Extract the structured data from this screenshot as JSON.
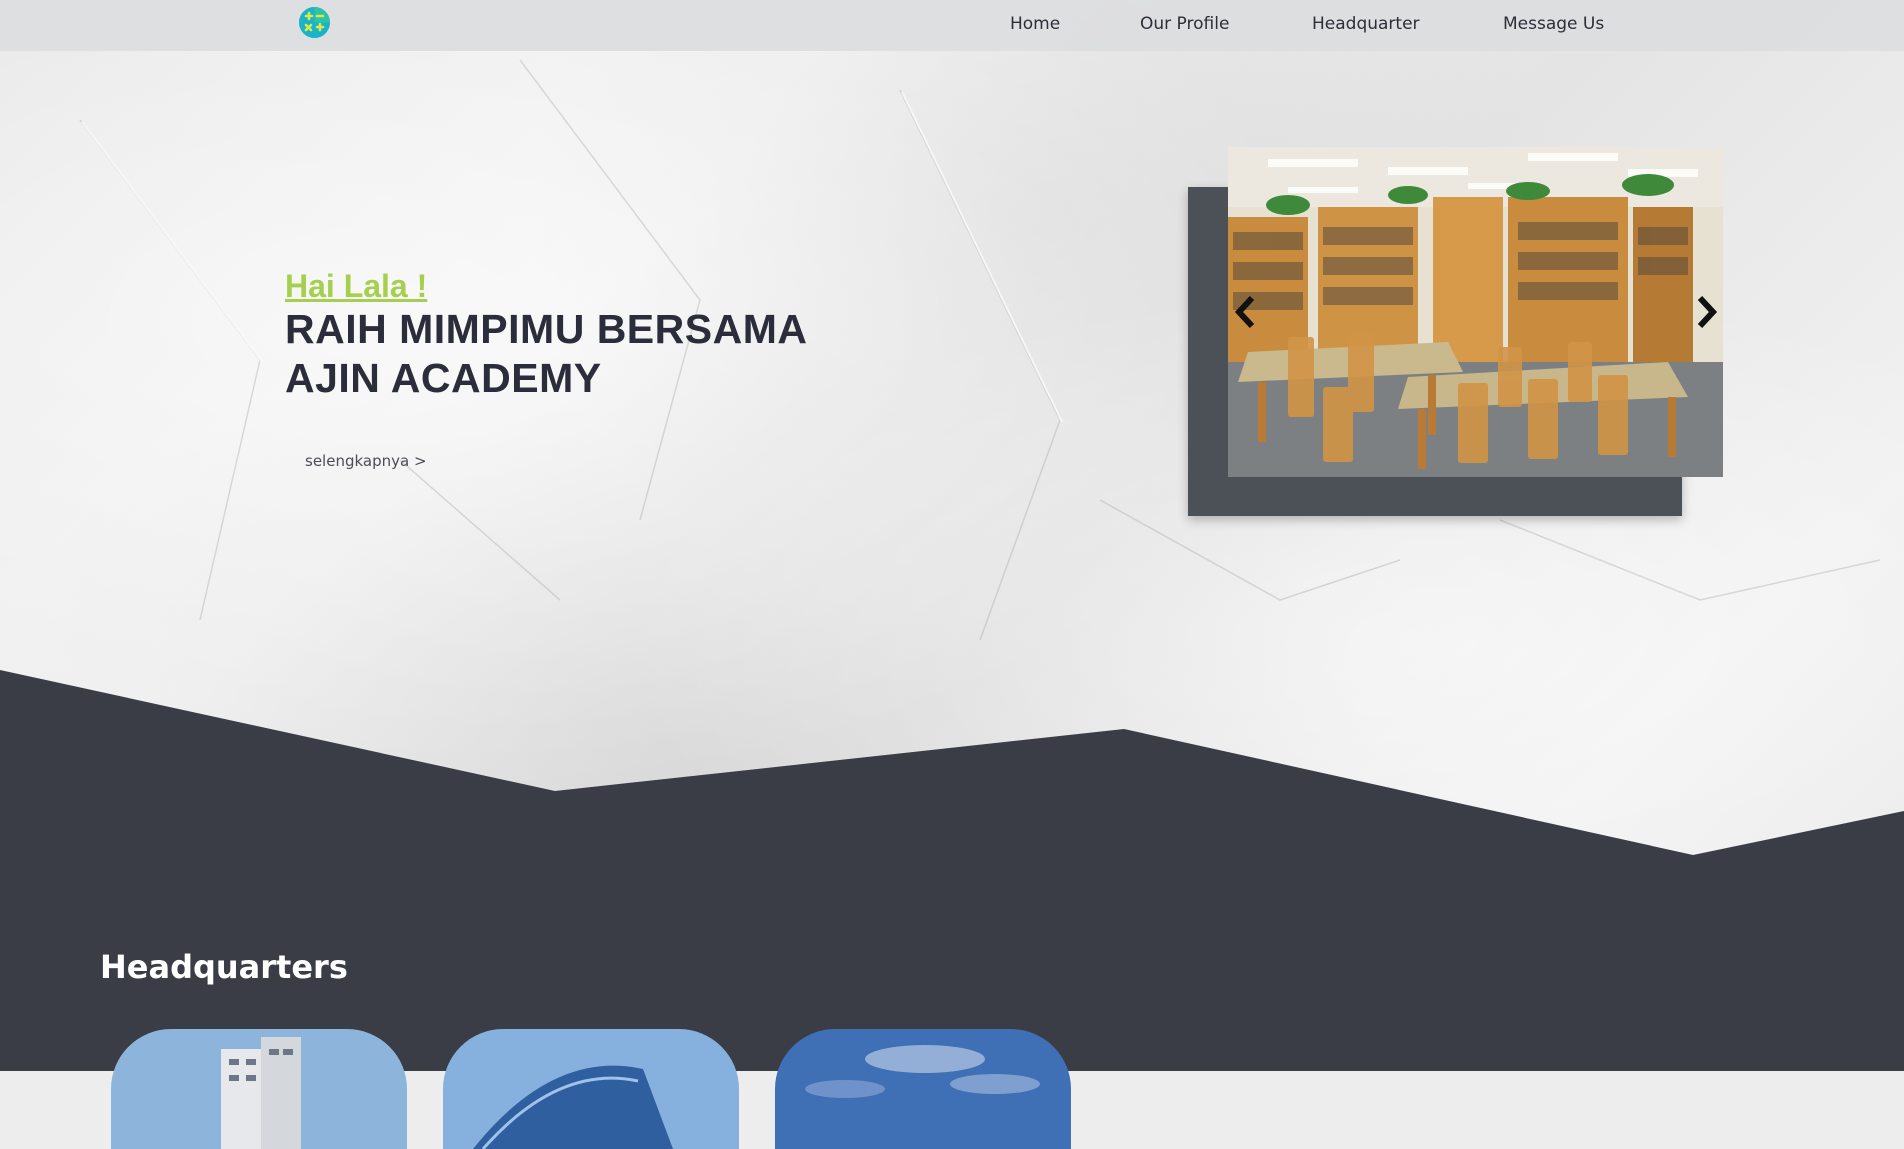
{
  "nav": {
    "logo_icon": "math-operators-logo",
    "items": [
      {
        "label": "Home"
      },
      {
        "label": "Our Profile"
      },
      {
        "label": "Headquarter"
      },
      {
        "label": "Message Us"
      }
    ]
  },
  "hero": {
    "greeting": "Hai Lala !",
    "headline_line1": "RAIH MIMPIMU BERSAMA",
    "headline_line2": "AJIN ACADEMY",
    "more_link": "selengkapnya >"
  },
  "carousel": {
    "slide_image": "library-interior",
    "prev_icon": "chevron-left-icon",
    "next_icon": "chevron-right-icon"
  },
  "headquarters": {
    "title": "Headquarters",
    "cards": [
      {
        "image": "building-photo"
      },
      {
        "image": "building-photo"
      },
      {
        "image": "sky-photo"
      }
    ]
  },
  "colors": {
    "accent": "#a6cf4f",
    "dark_section": "#3a3d46",
    "heading": "#2b2e3a",
    "navbar": "#dcdddf"
  }
}
